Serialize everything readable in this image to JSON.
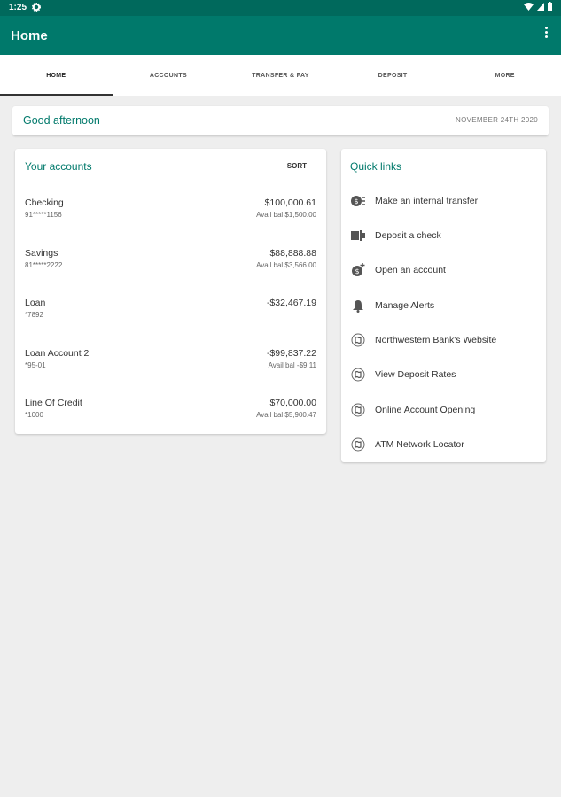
{
  "status_bar": {
    "time": "1:25"
  },
  "app_bar": {
    "title": "Home"
  },
  "tabs": [
    {
      "label": "HOME",
      "active": true
    },
    {
      "label": "ACCOUNTS",
      "active": false
    },
    {
      "label": "TRANSFER & PAY",
      "active": false
    },
    {
      "label": "DEPOSIT",
      "active": false
    },
    {
      "label": "MORE",
      "active": false
    }
  ],
  "greeting": {
    "text": "Good afternoon",
    "date": "NOVEMBER 24TH 2020"
  },
  "accounts": {
    "title": "Your accounts",
    "sort_label": "SORT",
    "items": [
      {
        "name": "Checking",
        "number": "91*****1156",
        "amount": "$100,000.61",
        "avail": "Avail bal $1,500.00"
      },
      {
        "name": "Savings",
        "number": "81*****2222",
        "amount": "$88,888.88",
        "avail": "Avail bal $3,566.00"
      },
      {
        "name": "Loan",
        "number": "*7892",
        "amount": "-$32,467.19",
        "avail": ""
      },
      {
        "name": "Loan Account 2",
        "number": "*95-01",
        "amount": "-$99,837.22",
        "avail": "Avail bal -$9.11"
      },
      {
        "name": "Line Of Credit",
        "number": "*1000",
        "amount": "$70,000.00",
        "avail": "Avail bal $5,900.47"
      }
    ]
  },
  "quick_links": {
    "title": "Quick links",
    "items": [
      {
        "label": "Make an internal transfer",
        "icon": "transfer-icon"
      },
      {
        "label": "Deposit a check",
        "icon": "deposit-check-icon"
      },
      {
        "label": "Open an account",
        "icon": "open-account-icon"
      },
      {
        "label": "Manage Alerts",
        "icon": "bell-icon"
      },
      {
        "label": "Northwestern Bank's Website",
        "icon": "map-icon"
      },
      {
        "label": "View Deposit Rates",
        "icon": "map-icon"
      },
      {
        "label": "Online Account Opening",
        "icon": "map-icon"
      },
      {
        "label": "ATM Network Locator",
        "icon": "map-icon"
      }
    ]
  },
  "colors": {
    "primary": "#00796b",
    "primary_dark": "#00695c",
    "background": "#eeeeee"
  }
}
